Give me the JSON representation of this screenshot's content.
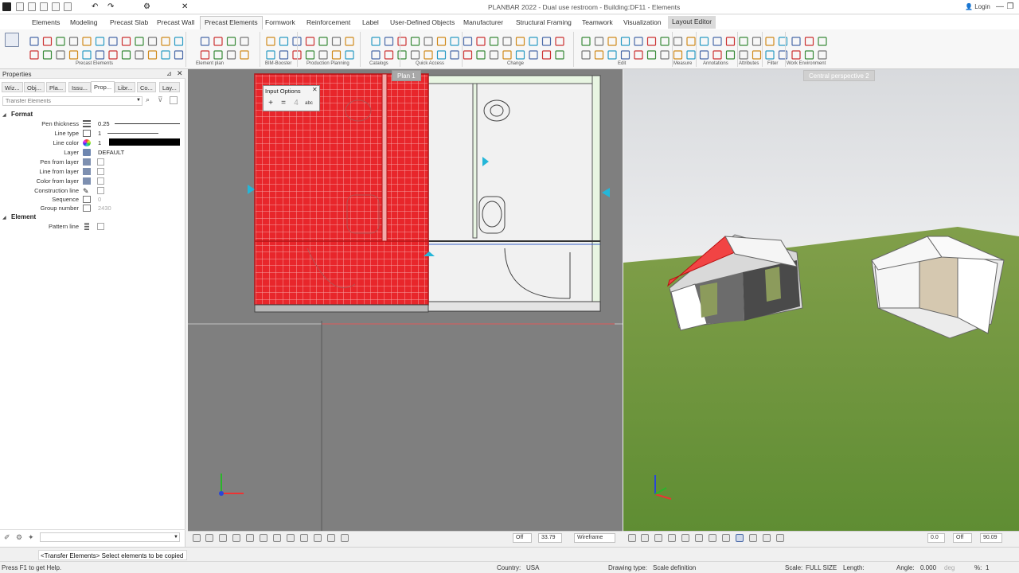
{
  "window": {
    "title": "PLANBAR 2022 - Dual use restroom - Building:DF11 - Elements",
    "login_label": "Login"
  },
  "menu": {
    "items": [
      "Elements",
      "Modeling",
      "Precast Slab",
      "Precast Wall",
      "Precast Elements",
      "Formwork",
      "Reinforcement",
      "Label",
      "User-Defined Objects",
      "Manufacturer",
      "Structural Framing",
      "Teamwork",
      "Visualization",
      "Layout Editor"
    ],
    "active": "Precast Elements",
    "highlighted": "Layout Editor"
  },
  "ribbon": {
    "groups": [
      "Precast Elements",
      "Element plan",
      "BIM-Booster",
      "Production Planning",
      "Catalogs",
      "Quick Access",
      "Change",
      "Edit",
      "Measure",
      "Annotations",
      "Attributes",
      "Filter",
      "Work Environment"
    ]
  },
  "properties": {
    "title": "Properties",
    "tabs": [
      "Wiz...",
      "Obj...",
      "Pla...",
      "Issu...",
      "Prop...",
      "Libr...",
      "Co...",
      "Lay..."
    ],
    "active_tab": "Prop...",
    "filter_placeholder": "Transfer Elements",
    "sections": {
      "format": "Format",
      "element": "Element"
    },
    "rows": {
      "pen_thickness": {
        "label": "Pen thickness",
        "value": "0.25"
      },
      "line_type": {
        "label": "Line type",
        "value": "1"
      },
      "line_color": {
        "label": "Line color",
        "value": "1"
      },
      "layer": {
        "label": "Layer",
        "value": "DEFAULT"
      },
      "pen_from_layer": {
        "label": "Pen from layer"
      },
      "line_from_layer": {
        "label": "Line from layer"
      },
      "color_from_layer": {
        "label": "Color from layer"
      },
      "construction_line": {
        "label": "Construction line"
      },
      "sequence": {
        "label": "Sequence",
        "value": "0"
      },
      "group_number": {
        "label": "Group number",
        "value": "2430"
      },
      "pattern_line": {
        "label": "Pattern line"
      }
    }
  },
  "plan": {
    "tab_label": "Plan 1",
    "input_options_title": "Input Options",
    "toolbar": {
      "snap": "Off",
      "scale": "33.79",
      "display_mode": "Wireframe"
    }
  },
  "view3d": {
    "tab_label": "Central perspective 2",
    "toolbar": {
      "value_a": "0.0",
      "snap": "Off",
      "angle": "90.09"
    }
  },
  "command": {
    "prompt": "<Transfer Elements> Select elements to be copied"
  },
  "status": {
    "help": "Press F1 to get Help.",
    "country_label": "Country:",
    "country": "USA",
    "drawing_type_label": "Drawing type:",
    "drawing_type": "Scale definition",
    "scale_label": "Scale:",
    "scale": "FULL SIZE",
    "length_label": "Length:",
    "angle_label": "Angle:",
    "angle": "0.000",
    "angle_unit": "deg",
    "percent_label": "%:",
    "percent": "1"
  },
  "colors": {
    "selection_red": "#e8262b",
    "grass": "#6f9b3c",
    "accent_cyan": "#24b6d8"
  }
}
